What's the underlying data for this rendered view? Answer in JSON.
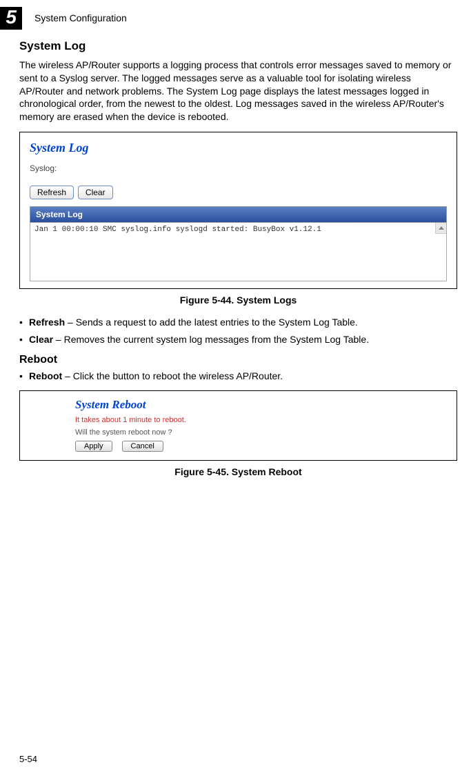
{
  "header": {
    "chapter_number": "5",
    "chapter_title": "System Configuration"
  },
  "section": {
    "title": "System Log",
    "body": "The wireless AP/Router supports a logging process that controls error messages saved to memory or sent to a Syslog server. The logged messages serve as a valuable tool for isolating wireless AP/Router and network problems. The System Log page displays the latest messages logged in chronological order, from the newest to the oldest. Log messages saved in the wireless AP/Router's memory are erased when the device is rebooted."
  },
  "figure1": {
    "panel_title": "System Log",
    "syslog_label": "Syslog:",
    "btn_refresh": "Refresh",
    "btn_clear": "Clear",
    "table_header": "System Log",
    "log_line": "Jan  1 00:00:10 SMC syslog.info syslogd started: BusyBox v1.12.1",
    "caption": "Figure 5-44.   System Logs"
  },
  "bullets1": [
    {
      "term": "Refresh",
      "desc": " – Sends a request to add the latest entries to the System Log Table."
    },
    {
      "term": "Clear",
      "desc": " – Removes the current system log messages from the System Log Table."
    }
  ],
  "section2": {
    "title": "Reboot"
  },
  "bullets2": [
    {
      "term": "Reboot",
      "desc": " – Click the button to reboot the wireless AP/Router."
    }
  ],
  "figure2": {
    "panel_title": "System Reboot",
    "red_text": "It takes about 1 minute to reboot.",
    "prompt": "Will the system reboot now ?",
    "btn_apply": "Apply",
    "btn_cancel": "Cancel",
    "caption": "Figure 5-45.   System Reboot"
  },
  "page_number": "5-54"
}
